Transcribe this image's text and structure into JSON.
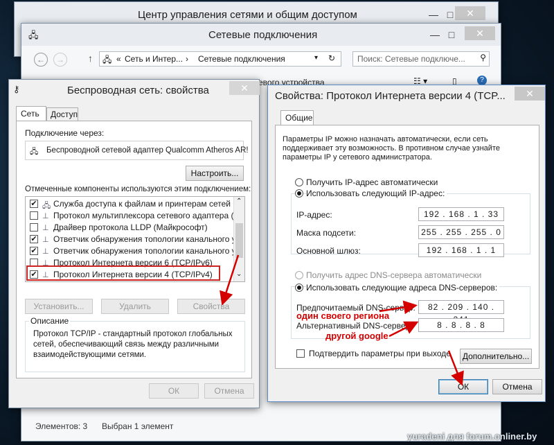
{
  "bg_window": {
    "title": "Центр управления сетями и общим доступом"
  },
  "explorer": {
    "title": "Сетевые подключения",
    "path_root": "Сеть и Интер...",
    "path_current": "Сетевые подключения",
    "search_placeholder": "Поиск: Сетевые подключе...",
    "toolbar_fragment": "евого устройства",
    "status_count": "Элементов: 3",
    "status_selected": "Выбран 1 элемент"
  },
  "wifi_props": {
    "title": "Беспроводная сеть: свойства",
    "tabs": [
      "Сеть",
      "Доступ"
    ],
    "connect_via_label": "Подключение через:",
    "adapter": "Беспроводной сетевой адаптер Qualcomm Atheros AR!",
    "configure_button": "Настроить...",
    "components_label": "Отмеченные компоненты используются этим подключением:",
    "components": [
      {
        "label": "Служба доступа к файлам и принтерам сетей Micro",
        "checked": true
      },
      {
        "label": "Протокол мультиплексора сетевого адаптера (Ма",
        "checked": false
      },
      {
        "label": "Драйвер протокола LLDP (Майкрософт)",
        "checked": false
      },
      {
        "label": "Ответчик обнаружения топологии канального уров",
        "checked": true
      },
      {
        "label": "Ответчик обнаружения топологии канального уров",
        "checked": true
      },
      {
        "label": "Протокол Интернета версии 6 (TCP/IPv6)",
        "checked": false
      },
      {
        "label": "Протокол Интернета версии 4 (TCP/IPv4)",
        "checked": true
      }
    ],
    "install_button": "Установить...",
    "remove_button": "Удалить",
    "properties_button": "Свойства",
    "description_title": "Описание",
    "description": "Протокол TCP/IP - стандартный протокол глобальных сетей, обеспечивающий связь между различными взаимодействующими сетями.",
    "ok_button": "ОК",
    "cancel_button": "Отмена"
  },
  "ipv4": {
    "title": "Свойства: Протокол Интернета версии 4 (TCP...",
    "tab": "Общие",
    "intro": "Параметры IP можно назначать автоматически, если сеть поддерживает эту возможность. В противном случае узнайте параметры IP у сетевого администратора.",
    "auto_ip": "Получить IP-адрес автоматически",
    "manual_ip": "Использовать следующий IP-адрес:",
    "ip_label": "IP-адрес:",
    "ip_value": "192 . 168 . 1 . 33",
    "mask_label": "Маска подсети:",
    "mask_value": "255 . 255 . 255 . 0",
    "gateway_label": "Основной шлюз:",
    "gateway_value": "192 . 168 . 1 . 1",
    "auto_dns": "Получить адрес DNS-сервера автоматически",
    "manual_dns": "Использовать следующие адреса DNS-серверов:",
    "pref_dns_label": "Предпочитаемый DNS-сервер:",
    "pref_dns_value": "82 . 209 . 140 . 241",
    "alt_dns_label": "Альтернативный DNS-сервер:",
    "alt_dns_value": "8 . 8 . 8 . 8",
    "validate_label": "Подтвердить параметры при выходе",
    "advanced_button": "Дополнительно...",
    "ok_button": "ОК",
    "cancel_button": "Отмена"
  },
  "annotations": {
    "pref_note": "один своего региона",
    "alt_note": "другой google",
    "watermark": "yuradeni для forum.onliner.by"
  },
  "colors": {
    "annotation": "#d40000",
    "selection_box": "#cc2222"
  }
}
